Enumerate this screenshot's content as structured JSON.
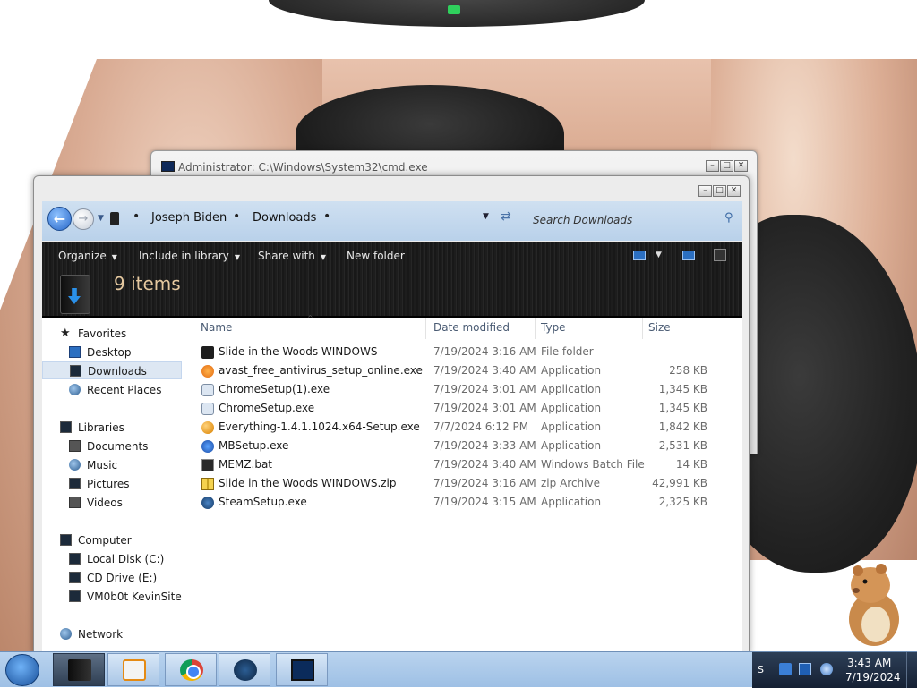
{
  "cmd_window": {
    "title": "Administrator: C:\\Windows\\System32\\cmd.exe",
    "controls": {
      "minimize": "–",
      "maximize": "□",
      "close": "✕"
    }
  },
  "explorer": {
    "controls": {
      "minimize": "–",
      "maximize": "□",
      "close": "✕"
    },
    "nav": {
      "back": "←",
      "forward": "→"
    },
    "breadcrumb": [
      "Joseph Biden",
      "Downloads"
    ],
    "breadcrumb_separator": "•",
    "search_placeholder": "Search Downloads",
    "toolbar": {
      "organize": "Organize",
      "include_in_library": "Include in library",
      "share_with": "Share with",
      "new_folder": "New folder"
    },
    "item_count": "9 items",
    "navigation": {
      "favorites": {
        "label": "Favorites",
        "items": [
          "Desktop",
          "Downloads",
          "Recent Places"
        ]
      },
      "libraries": {
        "label": "Libraries",
        "items": [
          "Documents",
          "Music",
          "Pictures",
          "Videos"
        ]
      },
      "computer": {
        "label": "Computer",
        "items": [
          "Local Disk (C:)",
          "CD Drive (E:)",
          "VM0b0t KevinSite"
        ]
      },
      "network": {
        "label": "Network"
      }
    },
    "selected_nav_item": "Downloads",
    "columns": {
      "name": "Name",
      "date": "Date modified",
      "type": "Type",
      "size": "Size"
    },
    "files": [
      {
        "name": "Slide in the Woods WINDOWS",
        "date": "7/19/2024 3:16 AM",
        "type": "File folder",
        "size": "",
        "icon": "folder-icon"
      },
      {
        "name": "avast_free_antivirus_setup_online.exe",
        "date": "7/19/2024 3:40 AM",
        "type": "Application",
        "size": "258 KB",
        "icon": "avast-icon"
      },
      {
        "name": "ChromeSetup(1).exe",
        "date": "7/19/2024 3:01 AM",
        "type": "Application",
        "size": "1,345 KB",
        "icon": "setup-icon"
      },
      {
        "name": "ChromeSetup.exe",
        "date": "7/19/2024 3:01 AM",
        "type": "Application",
        "size": "1,345 KB",
        "icon": "setup-icon"
      },
      {
        "name": "Everything-1.4.1.1024.x64-Setup.exe",
        "date": "7/7/2024 6:12 PM",
        "type": "Application",
        "size": "1,842 KB",
        "icon": "magnifier-icon"
      },
      {
        "name": "MBSetup.exe",
        "date": "7/19/2024 3:33 AM",
        "type": "Application",
        "size": "2,531 KB",
        "icon": "malwarebytes-icon"
      },
      {
        "name": "MEMZ.bat",
        "date": "7/19/2024 3:40 AM",
        "type": "Windows Batch File",
        "size": "14 KB",
        "icon": "batch-icon"
      },
      {
        "name": "Slide in the Woods WINDOWS.zip",
        "date": "7/19/2024 3:16 AM",
        "type": "zip Archive",
        "size": "42,991 KB",
        "icon": "zip-icon"
      },
      {
        "name": "SteamSetup.exe",
        "date": "7/19/2024 3:15 AM",
        "type": "Application",
        "size": "2,325 KB",
        "icon": "steam-icon"
      }
    ]
  },
  "taskbar": {
    "apps": [
      "explorer-icon",
      "media-player-icon",
      "chrome-icon",
      "steam-icon",
      "cmd-icon"
    ],
    "tray_text": "S",
    "time": "3:43 AM",
    "date": "7/19/2024"
  },
  "colors": {
    "navbar": "#c5daf0",
    "command_bar": "#1d1d1d",
    "item_count": "#e6c9a0",
    "selected_nav": "#dde7f3",
    "taskbar": "#a9c6e6"
  }
}
